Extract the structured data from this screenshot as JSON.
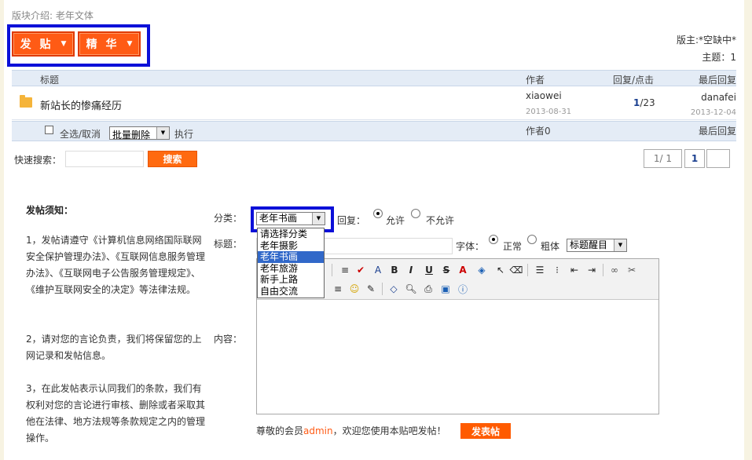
{
  "board": {
    "intro": "版块介绍: 老年文体",
    "post_label": "发 贴",
    "elite_label": "精 华",
    "moderator": "版主:*空缺中*",
    "topic_count": "主题：1"
  },
  "table": {
    "headers": {
      "title": "标题",
      "author": "作者",
      "reply_click": "回复/点击",
      "last_reply": "最后回复"
    },
    "rows": [
      {
        "title": "新站长的惨痛经历",
        "author": "xiaowei",
        "date": "2013-08-31",
        "replies": "1",
        "clicks": "/23",
        "last_user": "danafei",
        "last_date": "2013-12-04"
      }
    ],
    "footer": {
      "select_all": "全选/取消",
      "batch_select": "批量删除",
      "execute": "执行",
      "author": "作者0",
      "last_reply": "最后回复"
    }
  },
  "search": {
    "label": "快速搜索：",
    "value": "",
    "button": "搜索"
  },
  "pager": {
    "info": "1/ 1",
    "current": "1",
    "next": ""
  },
  "notice": {
    "heading": "发帖须知：",
    "p1": "1，发帖请遵守《计算机信息网络国际联网安全保护管理办法》、《互联网信息服务管理办法》、《互联网电子公告服务管理规定》、《维护互联网安全的决定》等法律法规。",
    "p2": "2，请对您的言论负责，我们将保留您的上网记录和发帖信息。",
    "p3": "3，在此发帖表示认同我们的条款，我们有权利对您的言论进行审核、删除或者采取其他在法律、地方法规等条款规定之内的管理操作。"
  },
  "form": {
    "category_label": "分类：",
    "category_value": "老年书画",
    "category_options": [
      "请选择分类",
      "老年摄影",
      "老年书画",
      "老年旅游",
      "新手上路",
      "自由交流"
    ],
    "category_selected_index": 2,
    "reply_label": "回复：",
    "allow": "允许",
    "disallow": "不允许",
    "title_label": "标题：",
    "title_value": "",
    "font_label": "字体：",
    "normal": "正常",
    "bold": "粗体",
    "highlight_select": "标题醒目",
    "content_label": "内容："
  },
  "welcome": {
    "prefix": "尊敬的会员",
    "user": "admin",
    "suffix": "，欢迎您使用本贴吧发帖！",
    "submit": "发表帖"
  },
  "colors": {
    "orange": "#ff5b15",
    "highlight_box": "#0c10d8",
    "header_bg": "#e4ecf6",
    "select_blue": "#3168c9"
  }
}
